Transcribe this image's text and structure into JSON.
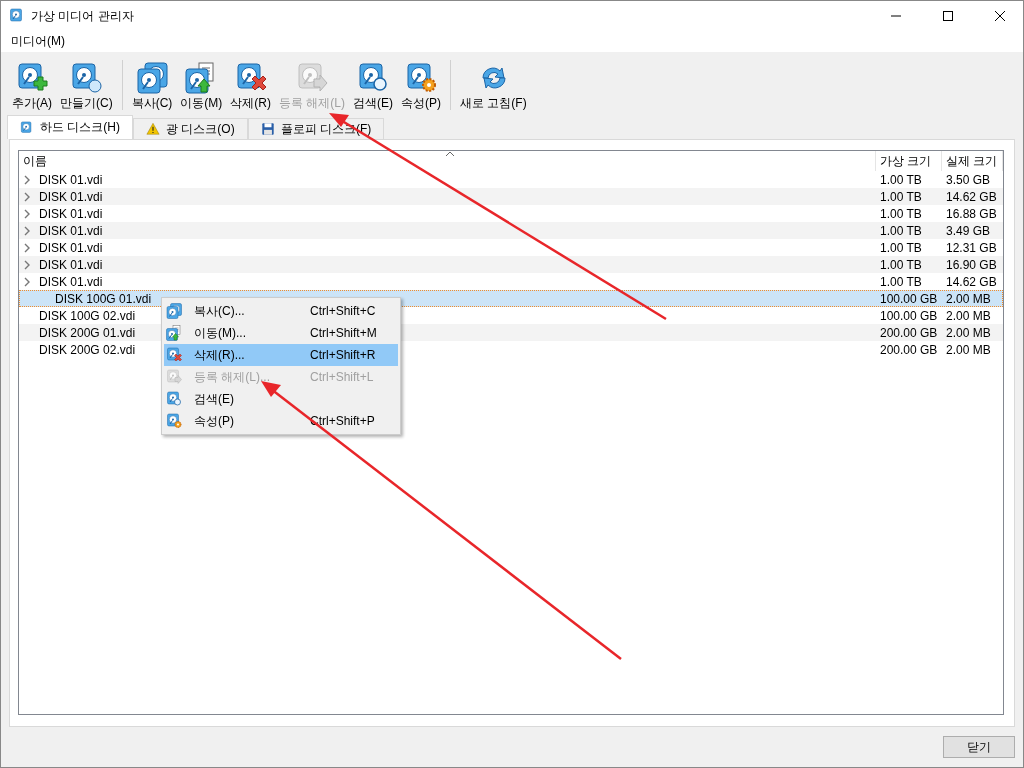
{
  "window": {
    "title": "가상 미디어 관리자"
  },
  "menu_bar": [
    "미디어(M)"
  ],
  "toolbar": [
    {
      "label": "추가(A)",
      "kind": "add",
      "disabled": false
    },
    {
      "label": "만들기(C)",
      "kind": "create",
      "disabled": false
    },
    {
      "kind": "separator"
    },
    {
      "label": "복사(C)",
      "kind": "copy",
      "disabled": false
    },
    {
      "label": "이동(M)",
      "kind": "move",
      "disabled": false
    },
    {
      "label": "삭제(R)",
      "kind": "remove",
      "disabled": false
    },
    {
      "label": "등록 해제(L)",
      "kind": "release",
      "disabled": true
    },
    {
      "label": "검색(E)",
      "kind": "search",
      "disabled": false
    },
    {
      "label": "속성(P)",
      "kind": "properties",
      "disabled": false
    },
    {
      "kind": "separator"
    },
    {
      "label": "새로 고침(F)",
      "kind": "refresh",
      "disabled": false
    }
  ],
  "tabs": [
    {
      "label": "하드 디스크(H)",
      "kind": "hdd",
      "selected": true
    },
    {
      "label": "광 디스크(O)",
      "kind": "optical",
      "selected": false
    },
    {
      "label": "플로피 디스크(F)",
      "kind": "floppy",
      "selected": false
    }
  ],
  "table": {
    "columns": [
      "이름",
      "가상 크기",
      "실제 크기"
    ],
    "rows": [
      {
        "name": "DISK 01.vdi",
        "virtual_size": "1.00 TB",
        "actual_size": "3.50 GB",
        "expandable": true,
        "selected": false
      },
      {
        "name": "DISK 01.vdi",
        "virtual_size": "1.00 TB",
        "actual_size": "14.62 GB",
        "expandable": true,
        "selected": false
      },
      {
        "name": "DISK 01.vdi",
        "virtual_size": "1.00 TB",
        "actual_size": "16.88 GB",
        "expandable": true,
        "selected": false
      },
      {
        "name": "DISK 01.vdi",
        "virtual_size": "1.00 TB",
        "actual_size": "3.49 GB",
        "expandable": true,
        "selected": false
      },
      {
        "name": "DISK 01.vdi",
        "virtual_size": "1.00 TB",
        "actual_size": "12.31 GB",
        "expandable": true,
        "selected": false
      },
      {
        "name": "DISK 01.vdi",
        "virtual_size": "1.00 TB",
        "actual_size": "16.90 GB",
        "expandable": true,
        "selected": false
      },
      {
        "name": "DISK 01.vdi",
        "virtual_size": "1.00 TB",
        "actual_size": "14.62 GB",
        "expandable": true,
        "selected": false
      },
      {
        "name": "DISK 100G 01.vdi",
        "virtual_size": "100.00 GB",
        "actual_size": "2.00 MB",
        "expandable": false,
        "selected": true
      },
      {
        "name": "DISK 100G 02.vdi",
        "virtual_size": "100.00 GB",
        "actual_size": "2.00 MB",
        "expandable": false,
        "selected": false
      },
      {
        "name": "DISK 200G 01.vdi",
        "virtual_size": "200.00 GB",
        "actual_size": "2.00 MB",
        "expandable": false,
        "selected": false
      },
      {
        "name": "DISK 200G 02.vdi",
        "virtual_size": "200.00 GB",
        "actual_size": "2.00 MB",
        "expandable": false,
        "selected": false
      }
    ]
  },
  "context_menu": {
    "items": [
      {
        "label": "복사(C)...",
        "shortcut": "Ctrl+Shift+C",
        "kind": "copy",
        "disabled": false,
        "selected": false
      },
      {
        "label": "이동(M)...",
        "shortcut": "Ctrl+Shift+M",
        "kind": "move",
        "disabled": false,
        "selected": false
      },
      {
        "label": "삭제(R)...",
        "shortcut": "Ctrl+Shift+R",
        "kind": "remove",
        "disabled": false,
        "selected": true
      },
      {
        "label": "등록 해제(L)...",
        "shortcut": "Ctrl+Shift+L",
        "kind": "release",
        "disabled": true,
        "selected": false
      },
      {
        "label": "검색(E)",
        "kind": "search",
        "disabled": false,
        "selected": false
      },
      {
        "label": "속성(P)",
        "shortcut": "Ctrl+Shift+P",
        "kind": "properties",
        "disabled": false,
        "selected": false
      }
    ]
  },
  "buttons": [
    "닫기"
  ]
}
